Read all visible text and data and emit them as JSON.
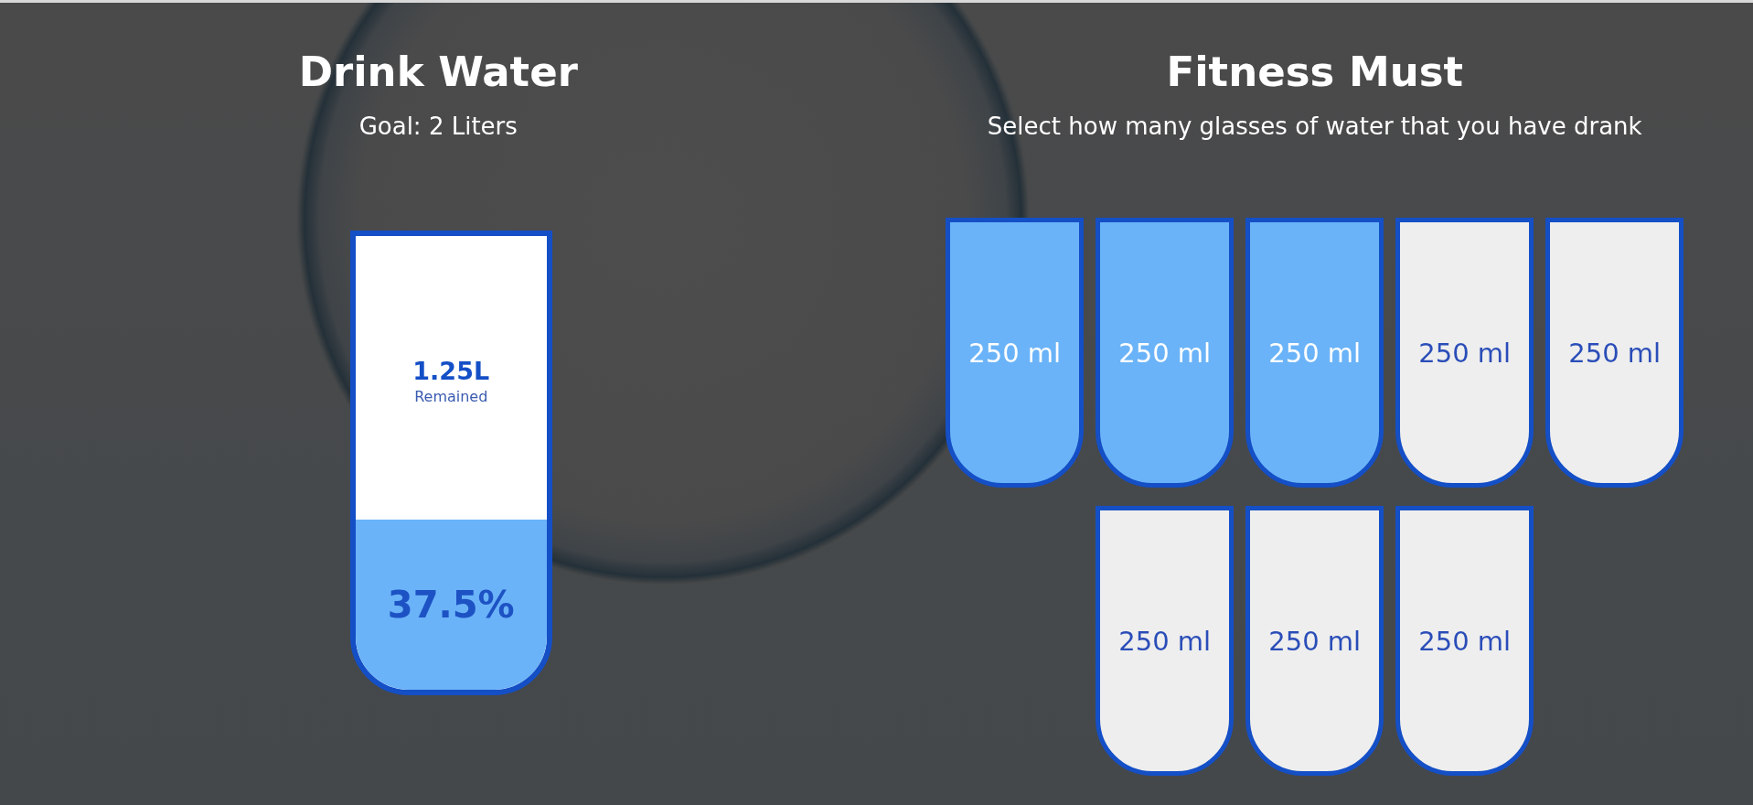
{
  "drink": {
    "title": "Drink Water",
    "goal": "Goal: 2 Liters",
    "cup": {
      "remained_amount": "1.25L",
      "remained_label": "Remained",
      "percentage": "37.5%",
      "level": 0.375
    }
  },
  "tracker": {
    "title": "Fitness Must",
    "instruction": "Select how many glasses of water that you have drank",
    "glasses": [
      {
        "label": "250 ml",
        "selected": true
      },
      {
        "label": "250 ml",
        "selected": true
      },
      {
        "label": "250 ml",
        "selected": true
      },
      {
        "label": "250 ml",
        "selected": false
      },
      {
        "label": "250 ml",
        "selected": false
      },
      {
        "label": "250 ml",
        "selected": false
      },
      {
        "label": "250 ml",
        "selected": false
      },
      {
        "label": "250 ml",
        "selected": false
      }
    ]
  }
}
